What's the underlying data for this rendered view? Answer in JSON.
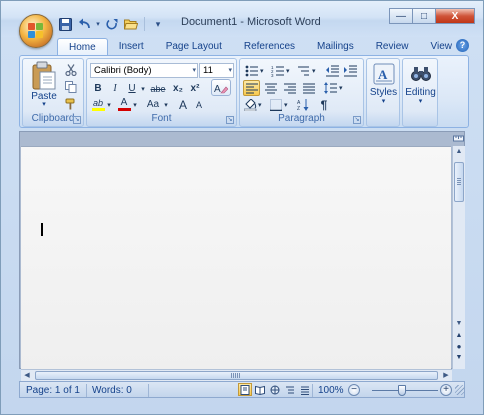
{
  "window": {
    "title": "Document1 - Microsoft Word",
    "controls": {
      "minimize": "—",
      "maximize": "□",
      "close": "X"
    }
  },
  "quick_access": {
    "save_icon": "save-icon",
    "undo_icon": "undo-icon",
    "redo_icon": "redo-icon",
    "open_icon": "open-icon",
    "customize_glyph": "▾"
  },
  "tabs": [
    "Home",
    "Insert",
    "Page Layout",
    "References",
    "Mailings",
    "Review",
    "View"
  ],
  "active_tab": "Home",
  "help_glyph": "?",
  "ribbon": {
    "clipboard": {
      "label": "Clipboard",
      "paste": "Paste"
    },
    "font": {
      "label": "Font",
      "font_name": "Calibri (Body)",
      "font_size": "11",
      "bold": "B",
      "italic": "I",
      "underline": "U",
      "strike": "abe",
      "subscript": "x₂",
      "superscript": "x²",
      "change_case": "Aa",
      "grow": "A",
      "shrink": "A",
      "highlight": "ab",
      "font_color": "A",
      "clear": "A"
    },
    "paragraph": {
      "label": "Paragraph",
      "pilcrow": "¶"
    },
    "styles": {
      "label": "Styles"
    },
    "editing": {
      "label": "Editing"
    }
  },
  "status": {
    "page": "Page: 1 of 1",
    "words": "Words: 0",
    "zoom": "100%",
    "zoom_minus": "−",
    "zoom_plus": "+"
  },
  "colors": {
    "accent": "#15428b",
    "highlight_yellow": "#ffff00",
    "font_red": "#d40000",
    "close_red": "#c8391c",
    "active_view": "#f7c94f"
  }
}
